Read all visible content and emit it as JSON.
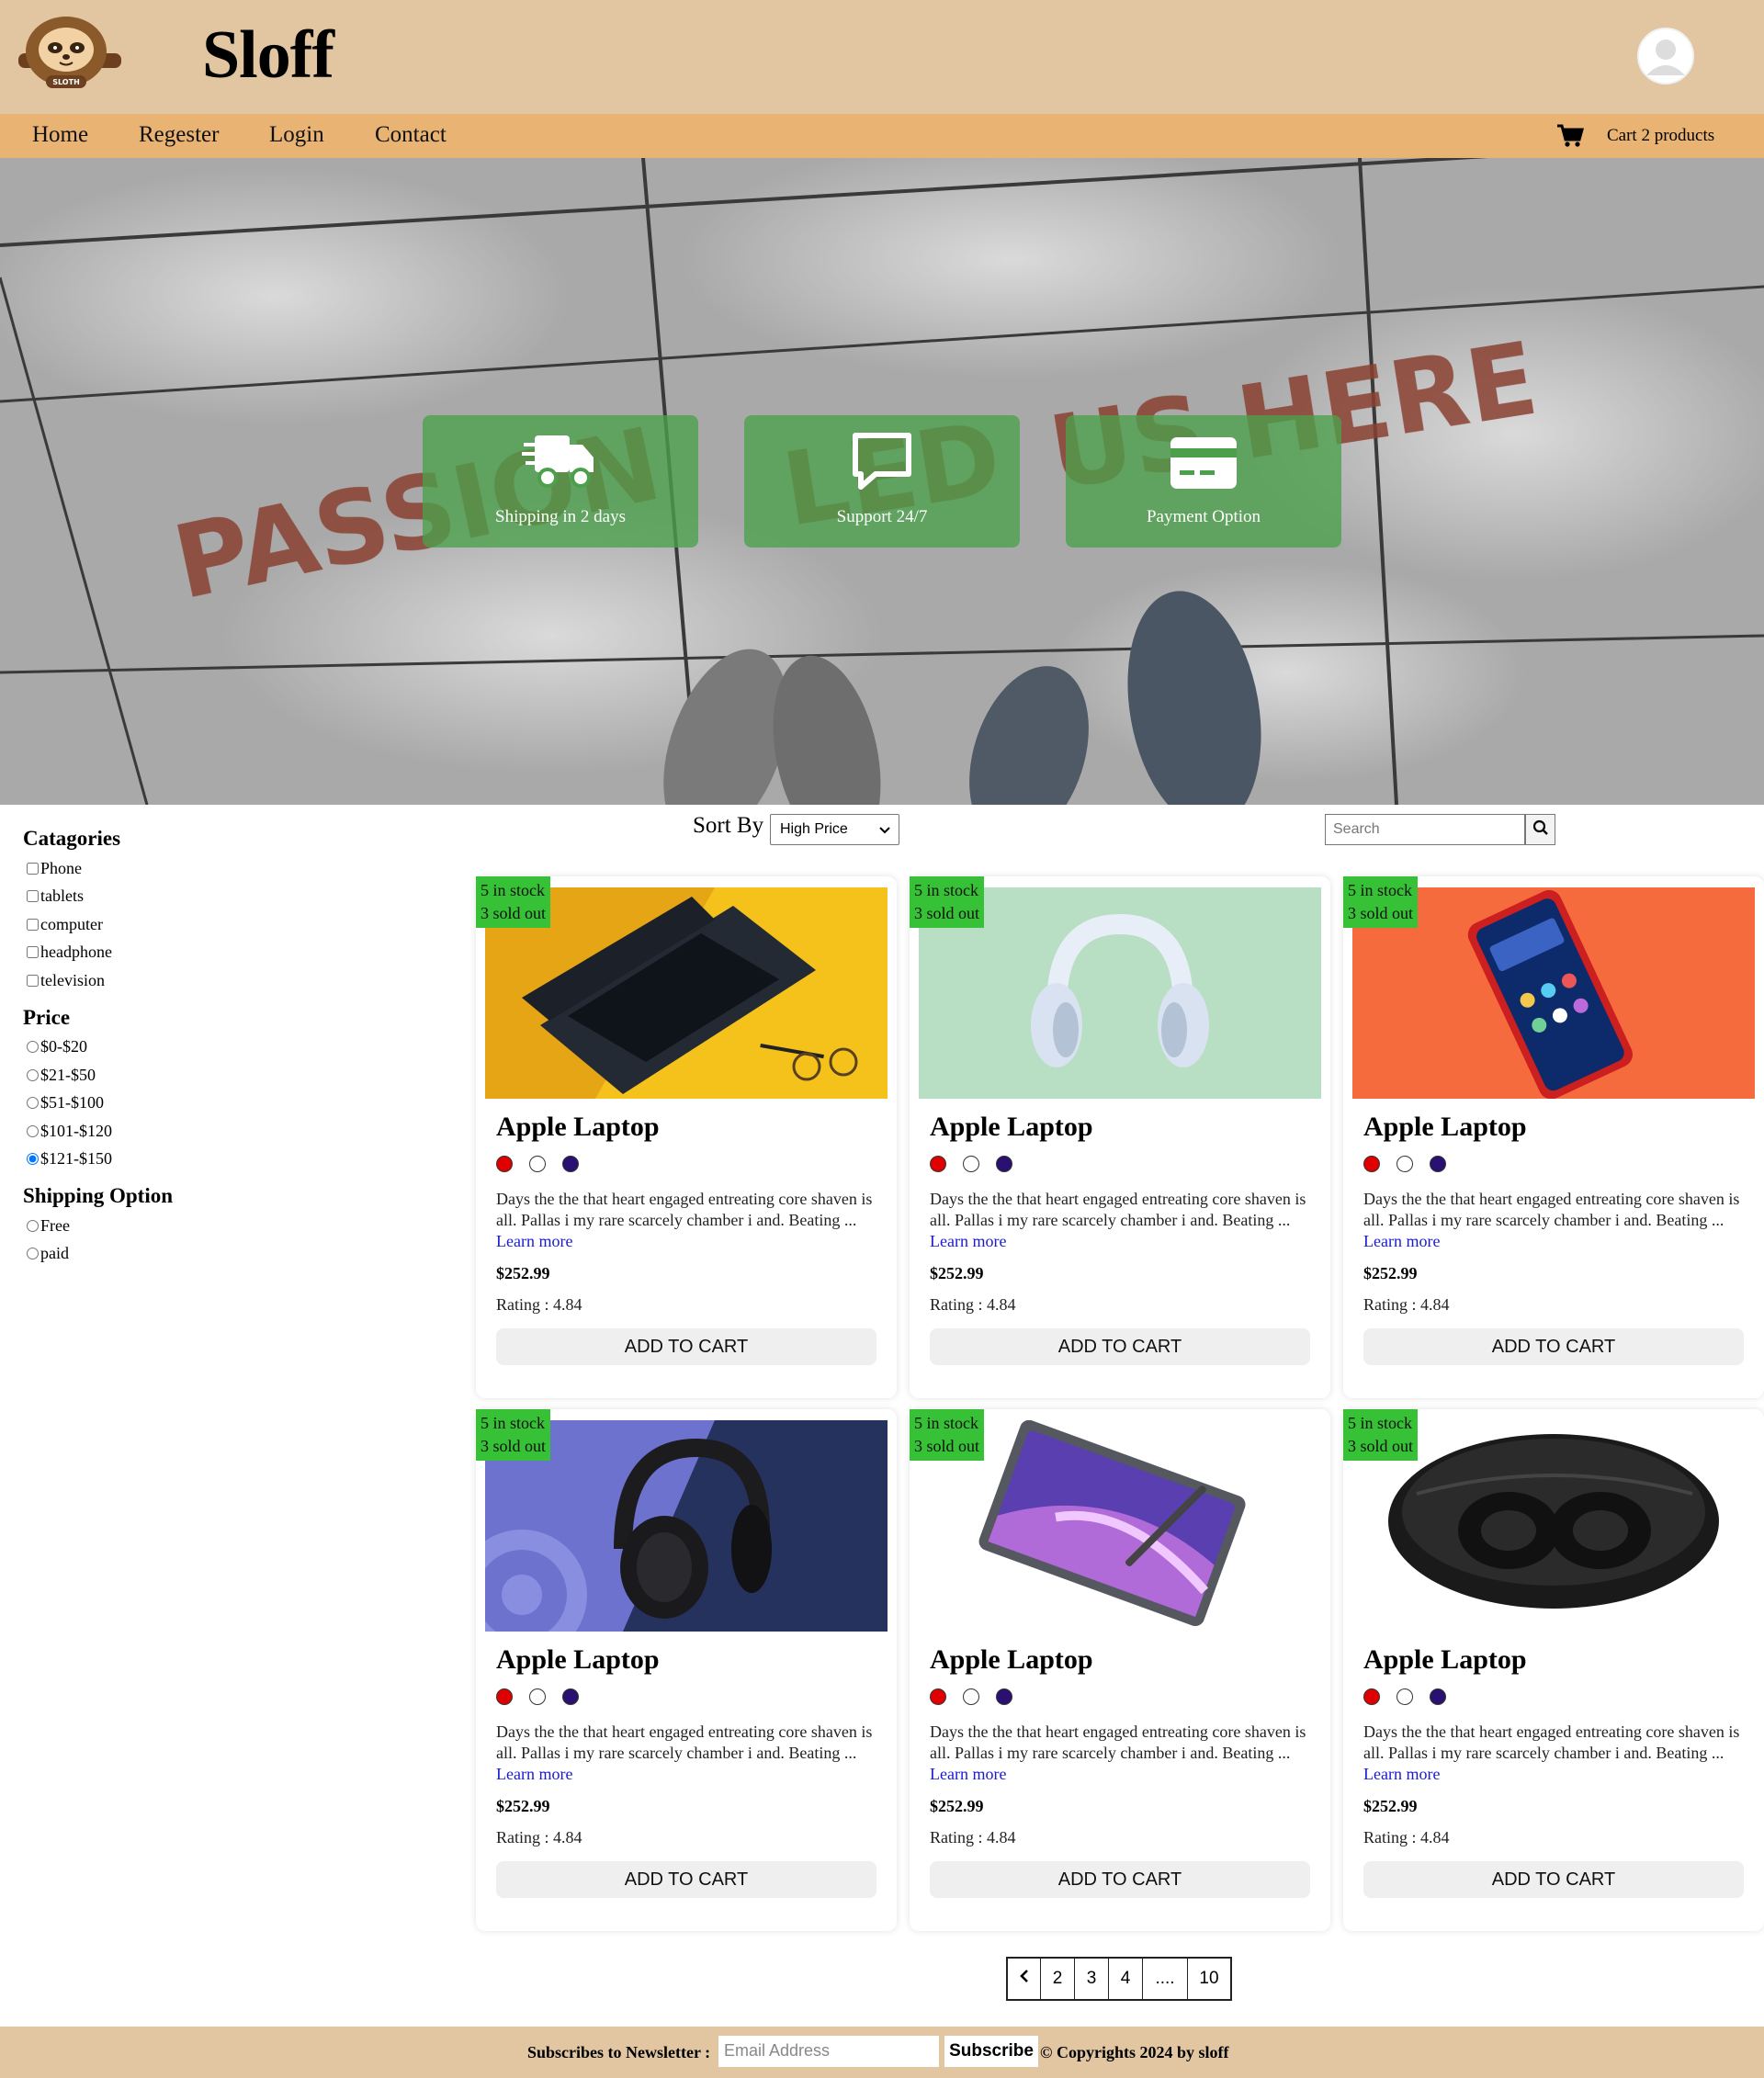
{
  "header": {
    "brand": "Sloff",
    "logo_text": "SLOTH",
    "avatar_icon": "user-avatar-icon"
  },
  "nav": {
    "items": [
      "Home",
      "Regester",
      "Login",
      "Contact"
    ],
    "cart_label": "Cart 2 products"
  },
  "hero": {
    "background_text": "PASSION LED US HERE",
    "features": [
      {
        "icon": "truck-icon",
        "label": "Shipping in 2 days"
      },
      {
        "icon": "chat-icon",
        "label": "Support 24/7"
      },
      {
        "icon": "credit-card-icon",
        "label": "Payment Option"
      }
    ]
  },
  "filters": {
    "categories_title": "Catagories",
    "categories": [
      "Phone",
      "tablets",
      "computer",
      "headphone",
      "television"
    ],
    "price_title": "Price",
    "prices": [
      "$0-$20",
      "$21-$50",
      "$51-$100",
      "$101-$120",
      "$121-$150"
    ],
    "price_selected": "$121-$150",
    "shipping_title": "Shipping Option",
    "shipping": [
      "Free",
      "paid"
    ]
  },
  "toolbar": {
    "sort_label": "Sort By",
    "sort_value": "High Price",
    "search_placeholder": "Search"
  },
  "products": [
    {
      "stock": "5 in stock",
      "sold": "3 sold out",
      "title": "Apple Laptop",
      "desc": "Days the the that heart engaged entreating core shaven is all. Pallas i my rare scarcely chamber i and. Beating ... ",
      "learn_more": "Learn more",
      "price": "$252.99",
      "rating": "Rating : 4.84",
      "button": "ADD TO CART",
      "image": "laptop"
    },
    {
      "stock": "5 in stock",
      "sold": "3 sold out",
      "title": "Apple Laptop",
      "desc": "Days the the that heart engaged entreating core shaven is all. Pallas i my rare scarcely chamber i and. Beating ... ",
      "learn_more": "Learn more",
      "price": "$252.99",
      "rating": "Rating : 4.84",
      "button": "ADD TO CART",
      "image": "headphones-white"
    },
    {
      "stock": "5 in stock",
      "sold": "3 sold out",
      "title": "Apple Laptop",
      "desc": "Days the the that heart engaged entreating core shaven is all. Pallas i my rare scarcely chamber i and. Beating ... ",
      "learn_more": "Learn more",
      "price": "$252.99",
      "rating": "Rating : 4.84",
      "button": "ADD TO CART",
      "image": "phone"
    },
    {
      "stock": "5 in stock",
      "sold": "3 sold out",
      "title": "Apple Laptop",
      "desc": "Days the the that heart engaged entreating core shaven is all. Pallas i my rare scarcely chamber i and. Beating ... ",
      "learn_more": "Learn more",
      "price": "$252.99",
      "rating": "Rating : 4.84",
      "button": "ADD TO CART",
      "image": "headphones-black"
    },
    {
      "stock": "5 in stock",
      "sold": "3 sold out",
      "title": "Apple Laptop",
      "desc": "Days the the that heart engaged entreating core shaven is all. Pallas i my rare scarcely chamber i and. Beating ... ",
      "learn_more": "Learn more",
      "price": "$252.99",
      "rating": "Rating : 4.84",
      "button": "ADD TO CART",
      "image": "tablet"
    },
    {
      "stock": "5 in stock",
      "sold": "3 sold out",
      "title": "Apple Laptop",
      "desc": "Days the the that heart engaged entreating core shaven is all. Pallas i my rare scarcely chamber i and. Beating ... ",
      "learn_more": "Learn more",
      "price": "$252.99",
      "rating": "Rating : 4.84",
      "button": "ADD TO CART",
      "image": "earbuds-case"
    }
  ],
  "color_swatches": [
    "#e00000",
    "#ffffff",
    "#2a1070"
  ],
  "pagination": [
    "2",
    "3",
    "4",
    "....",
    "10"
  ],
  "footer": {
    "newsletter_label": "Subscribes to Newsletter :",
    "email_placeholder": "Email Address",
    "subscribe": "Subscribe",
    "copyright": "© Copyrights 2024 by sloff"
  },
  "colors": {
    "header_bg": "#e2c5a1",
    "nav_bg": "#e8b373",
    "stock_badge": "#36c136",
    "feature_box": "#4ca04c",
    "link": "#1a1ad4"
  }
}
